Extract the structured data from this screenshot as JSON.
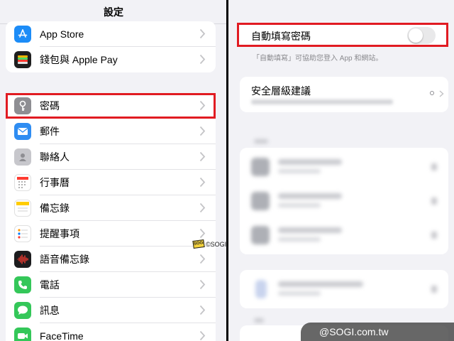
{
  "left": {
    "title": "設定",
    "group1": [
      {
        "label": "App Store",
        "icon": "app-store-icon",
        "color": "#1c8cf7"
      },
      {
        "label": "錢包與 Apple Pay",
        "icon": "wallet-icon",
        "color": "#1f1f1f"
      }
    ],
    "group2": [
      {
        "label": "密碼",
        "icon": "key-icon",
        "color": "#8e8e93"
      },
      {
        "label": "郵件",
        "icon": "mail-icon",
        "color": "#2f8df2"
      },
      {
        "label": "聯絡人",
        "icon": "contacts-icon",
        "color": "#a9a9ad"
      },
      {
        "label": "行事曆",
        "icon": "calendar-icon",
        "color": "#ffffff"
      },
      {
        "label": "備忘錄",
        "icon": "notes-icon",
        "color": "#ffffff"
      },
      {
        "label": "提醒事項",
        "icon": "reminders-icon",
        "color": "#ffffff"
      },
      {
        "label": "語音備忘錄",
        "icon": "voice-memos-icon",
        "color": "#1c1c1e"
      },
      {
        "label": "電話",
        "icon": "phone-icon",
        "color": "#34c759"
      },
      {
        "label": "訊息",
        "icon": "messages-icon",
        "color": "#34c759"
      },
      {
        "label": "FaceTime",
        "icon": "facetime-icon",
        "color": "#34c759"
      }
    ]
  },
  "right": {
    "autofill_label": "自動填寫密碼",
    "autofill_enabled": false,
    "autofill_footer": "「自動填寫」可協助您登入 App 和網站。",
    "security_title": "安全層級建議"
  },
  "watermarks": {
    "bottom": "@SOGI.com.tw",
    "mid_badge": "SOGI",
    "mid_text": "©SOGI.com.tw"
  },
  "colors": {
    "highlight": "#e11b22",
    "toggle_off": "#e9e9ea",
    "chevron": "#c4c4c7"
  }
}
